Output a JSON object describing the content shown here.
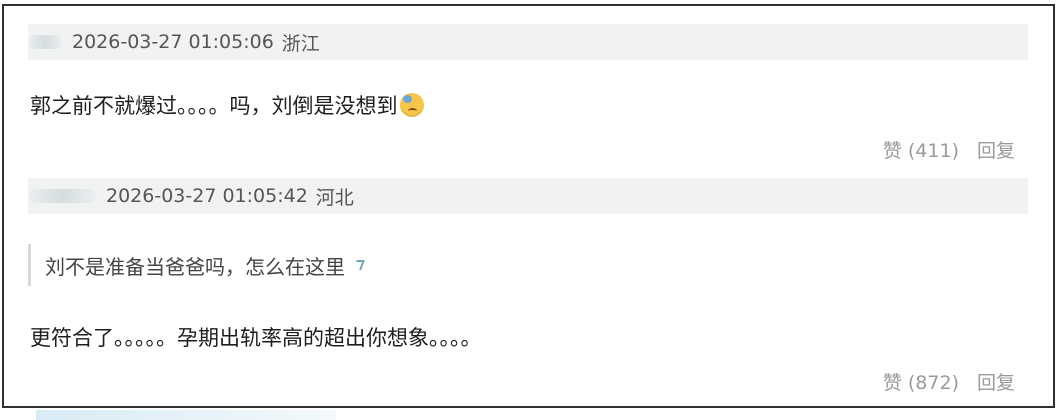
{
  "comments": [
    {
      "time": "2026-03-27 01:05:06",
      "location": "浙江",
      "text": "郭之前不就爆过。。。。吗，刘倒是没想到",
      "emoji": "cold-sweat-face-icon",
      "like_label": "赞",
      "like_count": "(411)",
      "reply_label": "回复"
    },
    {
      "time": "2026-03-27 01:05:42",
      "location": "河北",
      "quote": "刘不是准备当爸爸吗，怎么在这里",
      "text": "更符合了。。。。。孕期出轨率高的超出你想象。。。。",
      "like_label": "赞",
      "like_count": "(872)",
      "reply_label": "回复"
    }
  ]
}
